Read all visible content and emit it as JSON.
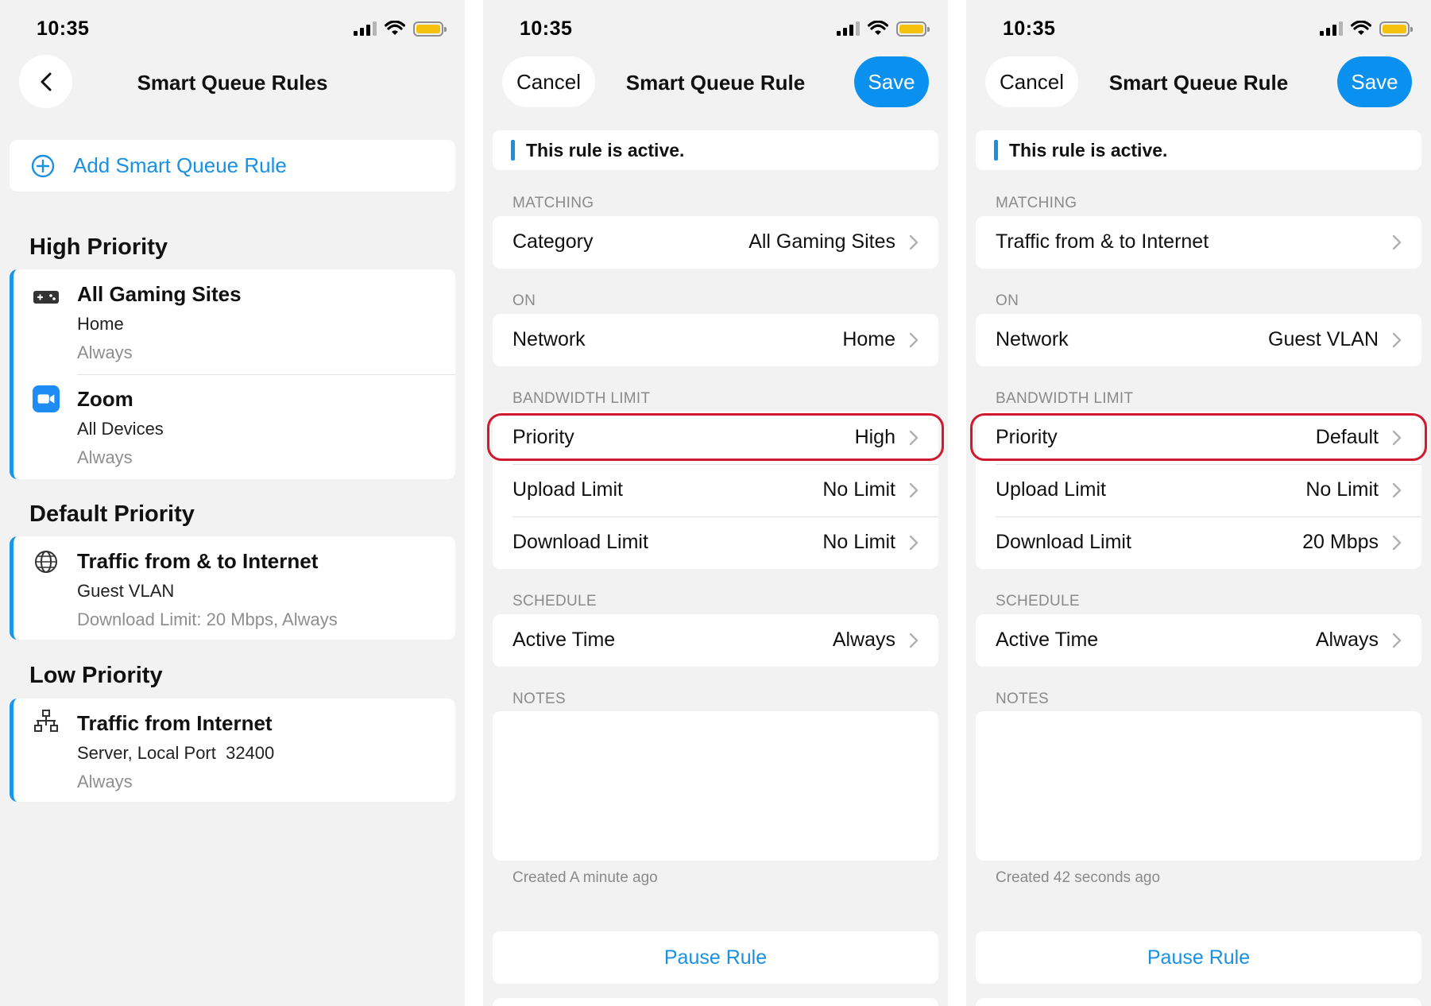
{
  "status_bar": {
    "time": "10:35"
  },
  "panel1": {
    "title": "Smart Queue Rules",
    "add_label": "Add Smart Queue Rule",
    "sections": [
      {
        "heading": "High Priority",
        "rules": [
          {
            "name": "All Gaming Sites",
            "target": "Home",
            "schedule": "Always",
            "icon": "gamepad-icon"
          },
          {
            "name": "Zoom",
            "target": "All Devices",
            "schedule": "Always",
            "icon": "zoom-video-icon"
          }
        ]
      },
      {
        "heading": "Default Priority",
        "rules": [
          {
            "name": "Traffic from & to Internet",
            "target": "Guest VLAN",
            "schedule": "Download Limit: 20 Mbps, Always",
            "icon": "globe-icon"
          }
        ]
      },
      {
        "heading": "Low Priority",
        "rules": [
          {
            "name": "Traffic from Internet",
            "target": "Server, Local Port  32400",
            "schedule": "Always",
            "icon": "network-icon"
          }
        ]
      }
    ]
  },
  "panel2": {
    "cancel": "Cancel",
    "title": "Smart Queue Rule",
    "save": "Save",
    "active_text": "This rule is active.",
    "matching_label": "MATCHING",
    "matching": {
      "key": "Category",
      "value": "All Gaming Sites"
    },
    "on_label": "ON",
    "on": {
      "key": "Network",
      "value": "Home"
    },
    "bandwidth_label": "BANDWIDTH LIMIT",
    "priority": {
      "key": "Priority",
      "value": "High"
    },
    "upload": {
      "key": "Upload Limit",
      "value": "No Limit"
    },
    "download": {
      "key": "Download Limit",
      "value": "No Limit"
    },
    "schedule_label": "SCHEDULE",
    "active_time": {
      "key": "Active Time",
      "value": "Always"
    },
    "notes_label": "NOTES",
    "notes_value": "",
    "created": "Created A minute ago",
    "pause": "Pause Rule"
  },
  "panel3": {
    "cancel": "Cancel",
    "title": "Smart Queue Rule",
    "save": "Save",
    "active_text": "This rule is active.",
    "matching_label": "MATCHING",
    "matching": {
      "key": "Traffic from & to Internet",
      "value": ""
    },
    "on_label": "ON",
    "on": {
      "key": "Network",
      "value": "Guest VLAN"
    },
    "bandwidth_label": "BANDWIDTH LIMIT",
    "priority": {
      "key": "Priority",
      "value": "Default"
    },
    "upload": {
      "key": "Upload Limit",
      "value": "No Limit"
    },
    "download": {
      "key": "Download Limit",
      "value": "20 Mbps"
    },
    "schedule_label": "SCHEDULE",
    "active_time": {
      "key": "Active Time",
      "value": "Always"
    },
    "notes_label": "NOTES",
    "notes_value": "",
    "created": "Created 42 seconds ago",
    "pause": "Pause Rule"
  },
  "colors": {
    "accent": "#1a90e0",
    "save_button": "#0a91ef",
    "highlight": "#d0182f",
    "background": "#f2f2f2",
    "battery": "#f4c20d"
  }
}
